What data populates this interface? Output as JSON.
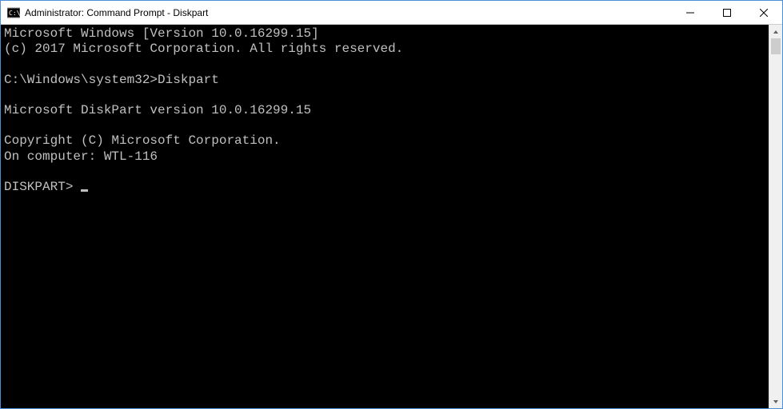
{
  "window": {
    "title": "Administrator: Command Prompt - Diskpart"
  },
  "terminal": {
    "line1": "Microsoft Windows [Version 10.0.16299.15]",
    "line2": "(c) 2017 Microsoft Corporation. All rights reserved.",
    "blank1": "",
    "prompt1": "C:\\Windows\\system32>Diskpart",
    "blank2": "",
    "line3": "Microsoft DiskPart version 10.0.16299.15",
    "blank3": "",
    "line4": "Copyright (C) Microsoft Corporation.",
    "line5": "On computer: WTL-116",
    "blank4": "",
    "prompt2": "DISKPART> "
  }
}
